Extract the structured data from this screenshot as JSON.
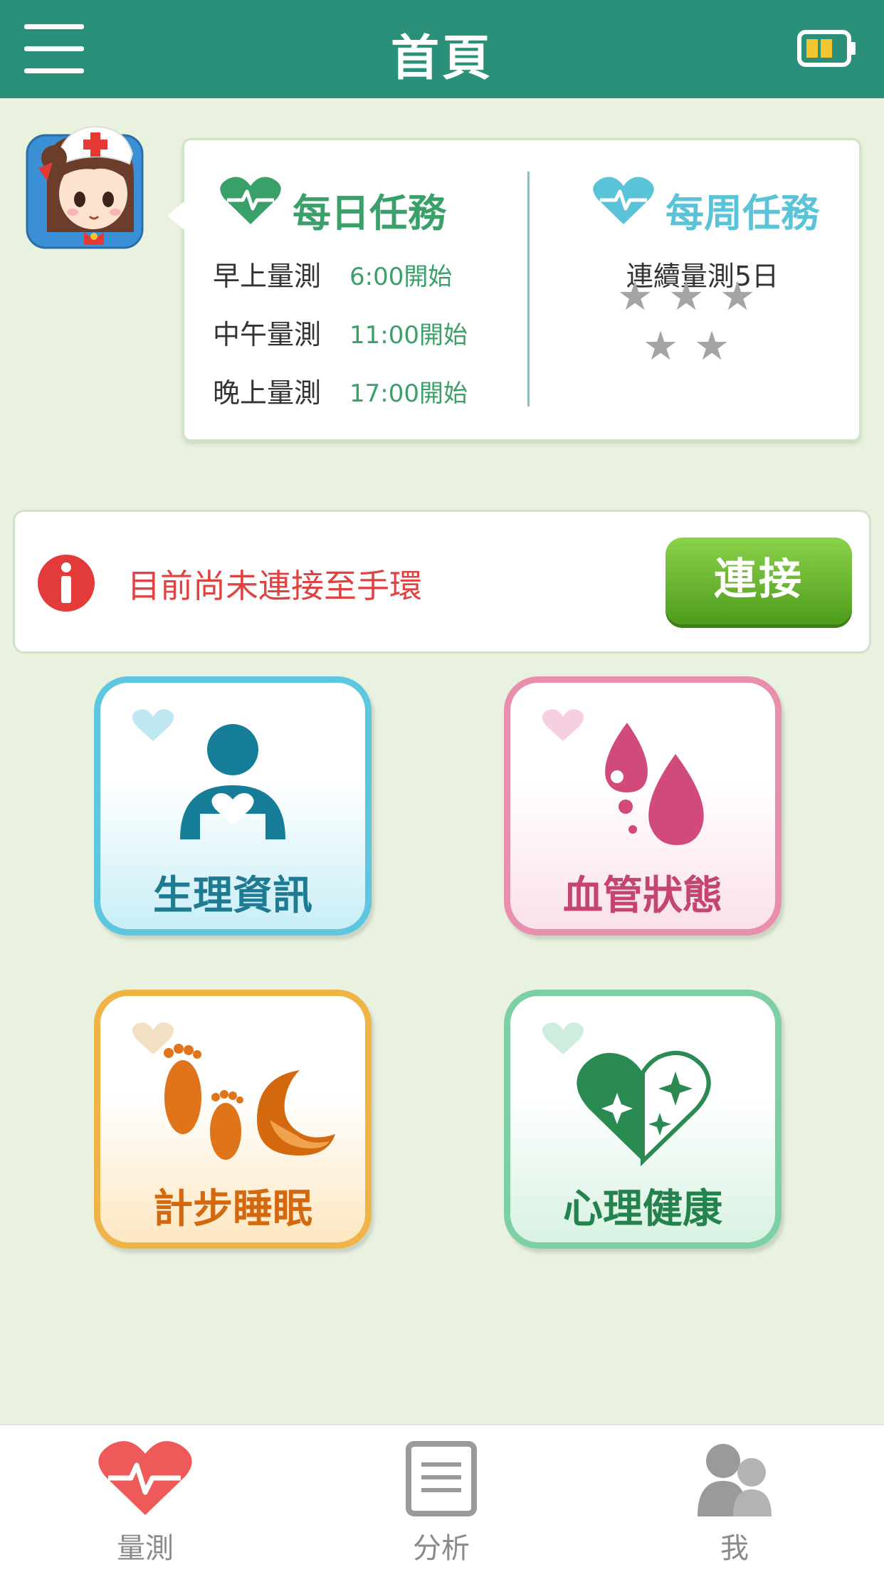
{
  "header": {
    "title": "首頁"
  },
  "daily": {
    "title": "每日任務",
    "tasks": [
      {
        "label": "早上量測",
        "time": "6:00開始"
      },
      {
        "label": "中午量測",
        "time": "11:00開始"
      },
      {
        "label": "晚上量測",
        "time": "17:00開始"
      }
    ]
  },
  "weekly": {
    "title": "每周任務",
    "text": "連續量測5日",
    "stars_earned": 0,
    "stars_total": 5
  },
  "connection": {
    "message": "目前尚未連接至手環",
    "button_label": "連接"
  },
  "tiles": [
    {
      "label": "生理資訊",
      "icon": "person-heart-icon"
    },
    {
      "label": "血管狀態",
      "icon": "blood-drop-icon"
    },
    {
      "label": "計步睡眠",
      "icon": "footprints-moon-icon"
    },
    {
      "label": "心理健康",
      "icon": "sparkle-heart-icon"
    }
  ],
  "tabs": [
    {
      "label": "量測",
      "icon": "heart-pulse-icon",
      "active": true
    },
    {
      "label": "分析",
      "icon": "document-icon",
      "active": false
    },
    {
      "label": "我",
      "icon": "people-icon",
      "active": false
    }
  ],
  "colors": {
    "header": "#2a9079",
    "background": "#e8f2df",
    "daily_accent": "#3aa06a",
    "weekly_accent": "#5bc3d8",
    "alert": "#e04141",
    "connect_button": "#5aa821",
    "active_tab": "#ee5a5a"
  }
}
